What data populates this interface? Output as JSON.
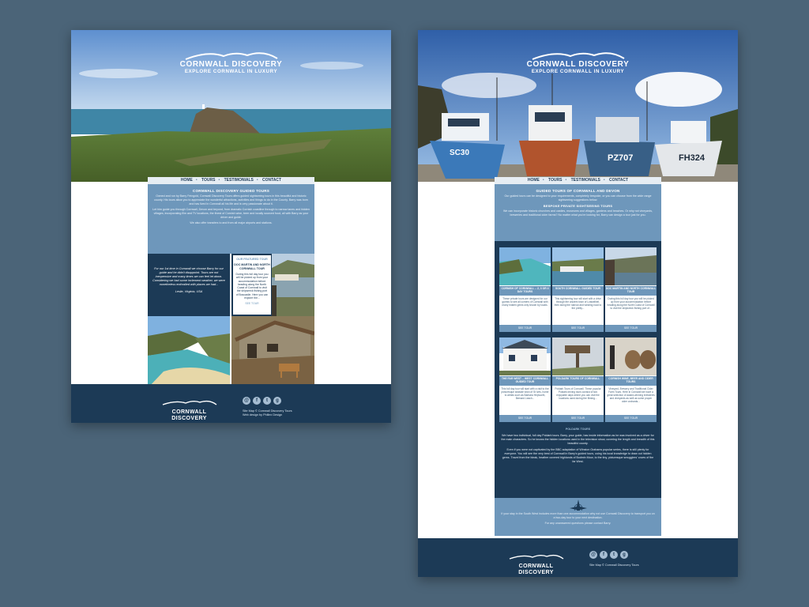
{
  "brand": {
    "name": "CORNWALL DISCOVERY",
    "tagline": "EXPLORE CORNWALL IN LUXURY"
  },
  "nav": {
    "home": "HOME",
    "tours": "TOURS",
    "testimonials": "TESTIMONIALS",
    "contact": "CONTACT"
  },
  "left": {
    "intro_title": "CORNWALL DISCOVERY GUIDED TOURS",
    "intro_p1": "Owned and run by Barry Feingold, Cornwall Discovery Tours offers guided sightseeing tours in this beautiful and historic county. His tours allow you to appreciate the wonderful attractions, activities and things to do in the County. Barry was born and has lived in Cornwall all his life and is very passionate about it.",
    "intro_p2": "Let him guide you through Cornwall, Devon and beyond, from dramatic Cornish coastline through to narrow lanes and hidden villages, incorporating film and TV locations, the finest of Cornish wine, beer and locally sourced food, all with Barry as your driver and guide.",
    "intro_p3": "We also offer transfers to and from all major airports and stations.",
    "quote_text": "For our 1st time in Cornwall we choose Barry for our guide and he didn't disappoint. Tours are not inexpensive and many times we can feel let down. Considering we had some inclement weather, we were nonetheless enthralled with places we had...",
    "quote_author": "Leslie, Virginia, USA",
    "featured_heading": "OUR FEATURED TOUR",
    "featured_title": "DOC MARTIN AND NORTH CORNWALL TOUR",
    "featured_body": "During this full day tour you will be picked up from your accommodation before heading along the North Coast of Cornwall to visit the shipwreck fishing port of Boscastle. Here you can explore the...",
    "featured_link": "SEE TOUR",
    "footer_sitemap": "Site Map",
    "footer_copyright": "© Cornwall Discovery Tours",
    "footer_design": "Web design by Phillex Design"
  },
  "right": {
    "intro_title": "GUIDED TOURS OF CORNWALL AND DEVON",
    "intro_p1": "Our guided tours can be designed to your requirements, completely bespoke, or you can choose from the wide range sightseeing suggestions below.",
    "bespoke_title": "BESPOKE PRIVATE SIGHTSEEING TOURS",
    "bespoke_text": "We can incorporate historic churches and castles, museums and villages, gardens and beaches. Or why not vineyards, breweries and traditional cider farms? No matter what you're looking for, Barry can design a tour just for you.",
    "tours": [
      {
        "title": "CORNISH OF CORNWALL – 2, 3 OR 4 DAY TOURS",
        "text": "These private tours are designed for our guests to see all corners of Cornwall with many hidden gems only known by locals.",
        "btn": "SEE TOUR"
      },
      {
        "title": "SOUTH CORNWALL GUIDED TOUR",
        "text": "This sightseeing tour will start with a drive through the ancient town of Lostwithiel, then along the narrow and winding road to the pretty...",
        "btn": "SEE TOUR"
      },
      {
        "title": "DOC MARTIN AND NORTH CORNWALL TOUR",
        "text": "During this full day tour you will be picked up from your accommodation before heading along the North Coast of Cornwall to visit the shipwreck fishing port of...",
        "btn": "SEE TOUR"
      },
      {
        "title": "THE FAR WEST – WEST CORNWALL GUIDED TOUR",
        "text": "This full day tour will start with a visit to the picturesque seaside town of St Ives, home to artists such as Barbara Hepworth, Bernard Leach...",
        "btn": "SEE TOUR"
      },
      {
        "title": "POLDARK TOURS OF CORNWALL",
        "text": "Poldark Tours of Cornwall. These popular Poldark driving tours consist of two enjoyable days where you can visit the locations used during the filming...",
        "btn": "SEE TOUR"
      },
      {
        "title": "CORNISH WINE, BEER AND CIDER TOURS",
        "text": "Vineyard, Brewery and Traditional Cider Farm Tours. Here in Cornwall we have a great selection of award-winning breweries and vineyards as well as some proper cider orchards...",
        "btn": "SEE TOUR"
      }
    ],
    "poldark_heading": "POLDARK TOURS",
    "poldark_p1": "We have two individual, full day Poldark tours. Barry, your guide, has inside information as he was involved as a driver for the main characters. So he knows the hidden locations used in the television show, covering the length and breadth of this beautiful county.",
    "poldark_p2": "Even if you were not captivated by the BBC adaptation of Winston Grahams popular series, there is still plenty for everyone. You will see the very best of Cornwall in Barry's guided tours, using his local knowledge to draw out hidden gems. Travel from the bleak, heather covered highlands of Bodmin Moor, to the tiny, picturesque smugglers' coves of the far West.",
    "lower_p1": "If your stay in the South West includes more than one accommodation why not use Cornwall Discovery to transport you on a two-day tour to your next destination.",
    "lower_p2": "For any unanswered questions please contact Barry.",
    "footer_sitemap": "Site Map",
    "footer_copyright": "© Cornwall Discovery Tours"
  },
  "colors": {
    "navy": "#1c3a56",
    "steel_blue": "#6e97bb",
    "backdrop": "#4b6478"
  }
}
